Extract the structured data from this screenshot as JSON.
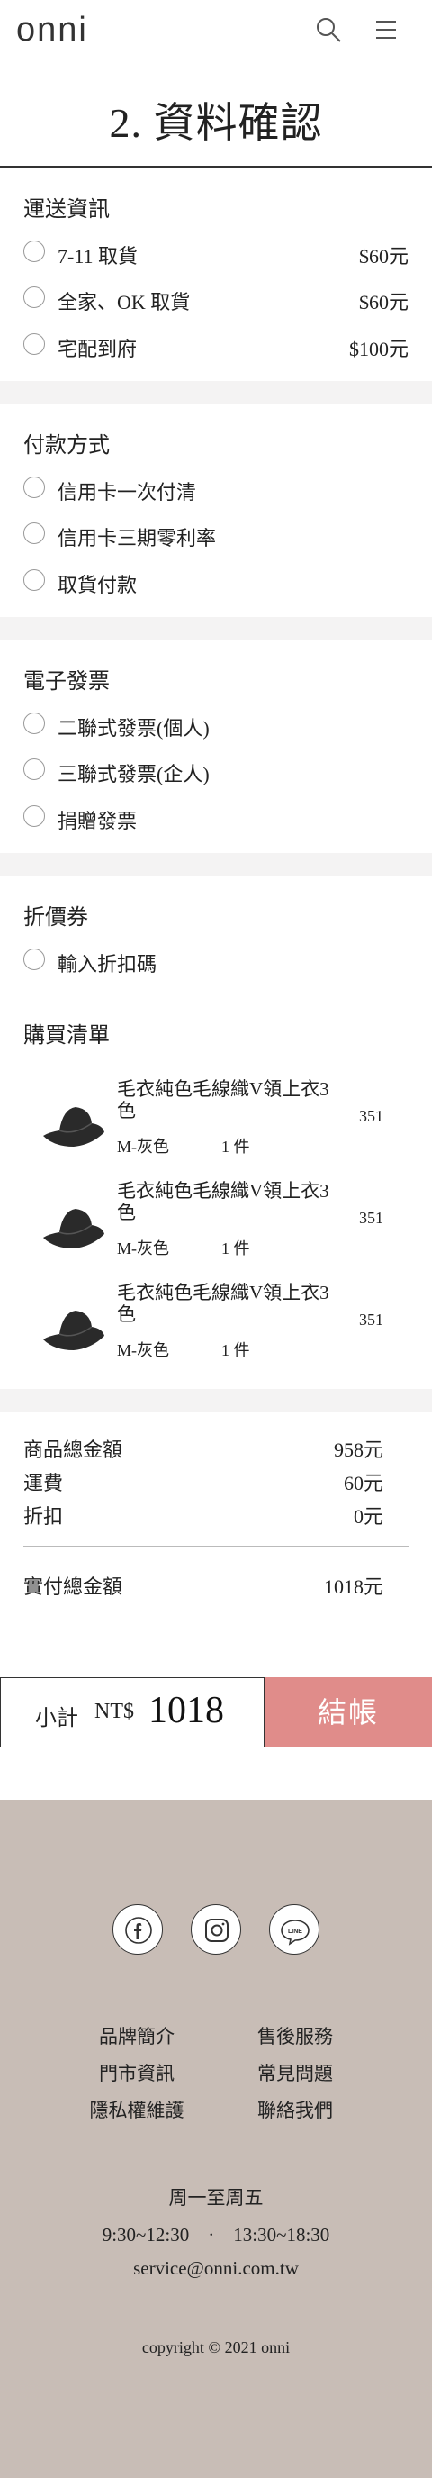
{
  "header": {
    "logo": "onni"
  },
  "page_title": "2. 資料確認",
  "shipping": {
    "title": "運送資訊",
    "options": [
      {
        "label": "7-11 取貨",
        "price": "$60元"
      },
      {
        "label": "全家、OK 取貨",
        "price": "$60元"
      },
      {
        "label": "宅配到府",
        "price": "$100元"
      }
    ]
  },
  "payment": {
    "title": "付款方式",
    "options": [
      {
        "label": "信用卡一次付清"
      },
      {
        "label": "信用卡三期零利率"
      },
      {
        "label": "取貨付款"
      }
    ]
  },
  "invoice": {
    "title": "電子發票",
    "options": [
      {
        "label": "二聯式發票(個人)"
      },
      {
        "label": "三聯式發票(企人)"
      },
      {
        "label": "捐贈發票"
      }
    ]
  },
  "coupon": {
    "title": "折價券",
    "option": "輸入折扣碼"
  },
  "cart": {
    "title": "購買清單",
    "items": [
      {
        "name": "毛衣純色毛線織V領上衣3色",
        "spec": "M-灰色",
        "qty": "1 件",
        "price": "351"
      },
      {
        "name": "毛衣純色毛線織V領上衣3色",
        "spec": "M-灰色",
        "qty": "1 件",
        "price": "351"
      },
      {
        "name": "毛衣純色毛線織V領上衣3色",
        "spec": "M-灰色",
        "qty": "1 件",
        "price": "351"
      }
    ]
  },
  "summary": {
    "goods_label": "商品總金額",
    "goods_value": "958元",
    "shipping_label": "運費",
    "shipping_value": "60元",
    "discount_label": "折扣",
    "discount_value": "0元",
    "total_label": "實付總金額",
    "total_value": "1018元"
  },
  "checkout": {
    "subtotal_label": "小計",
    "currency": "NT$",
    "subtotal_value": "1018",
    "button_label": "結帳"
  },
  "footer": {
    "links_left": [
      "品牌簡介",
      "門市資訊",
      "隱私權維護"
    ],
    "links_right": [
      "售後服務",
      "常見問題",
      "聯絡我們"
    ],
    "hours_days": "周一至周五",
    "hours_time": "9:30~12:30　·　13:30~18:30",
    "email": "service@onni.com.tw",
    "copyright": "copyright © 2021 onni",
    "social": [
      "facebook-icon",
      "instagram-icon",
      "line-icon"
    ]
  },
  "colors": {
    "accent": "#e08c8a",
    "footer_bg": "#c8bdb6",
    "band": "#f4f3f3"
  }
}
